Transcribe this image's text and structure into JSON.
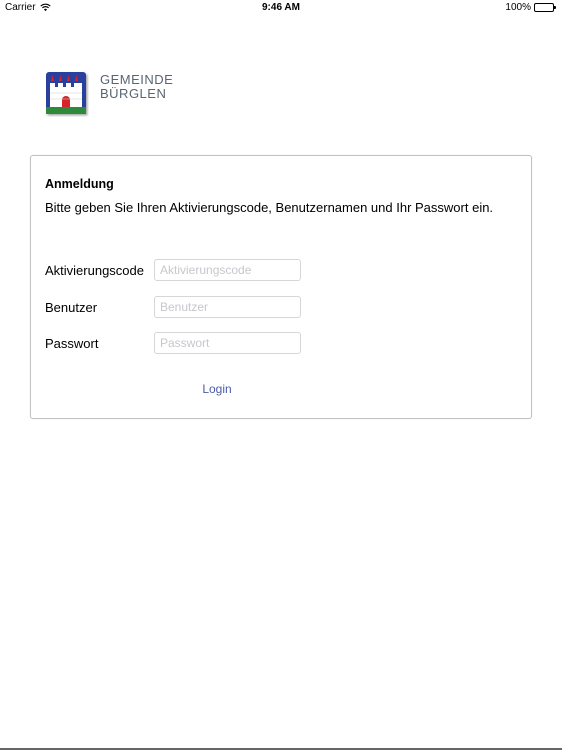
{
  "status_bar": {
    "carrier": "Carrier",
    "time": "9:46 AM",
    "battery": "100%"
  },
  "brand": {
    "line1": "GEMEINDE",
    "line2": "BÜRGLEN",
    "logo_icon": "coat-of-arms-icon"
  },
  "login": {
    "title": "Anmeldung",
    "description": "Bitte geben Sie Ihren Aktivierungscode, Benutzernamen und Ihr Passwort ein.",
    "fields": [
      {
        "label": "Aktivierungscode",
        "placeholder": "Aktivierungscode",
        "value": ""
      },
      {
        "label": "Benutzer",
        "placeholder": "Benutzer",
        "value": ""
      },
      {
        "label": "Passwort",
        "placeholder": "Passwort",
        "value": ""
      }
    ],
    "button_label": "Login"
  },
  "colors": {
    "link": "#4a5ca8",
    "brand_text": "#5a6573",
    "card_border": "#c2c2c2",
    "logo_blue": "#2a3f9e",
    "logo_red": "#d4262b",
    "logo_green": "#2f8a3a"
  }
}
